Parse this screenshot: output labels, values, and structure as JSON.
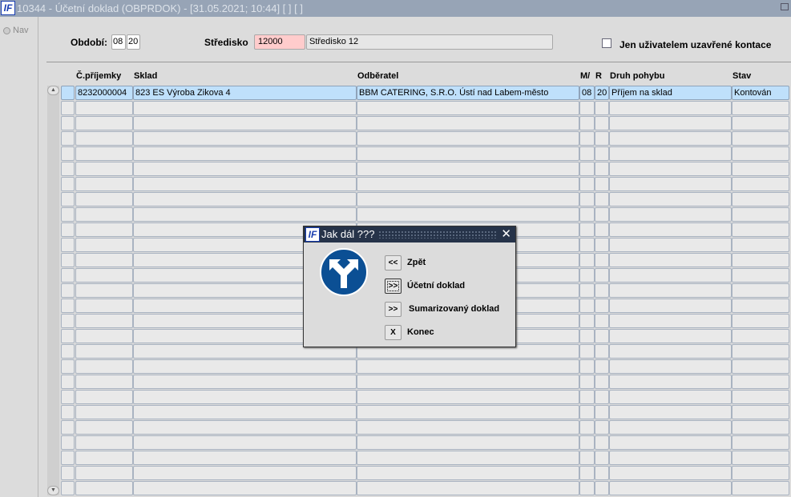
{
  "window": {
    "title": "10344 - Účetní doklad (OBPRDOK) - [31.05.2021; 10:44]  [ ]  [ ]",
    "logo": "IF"
  },
  "nav": {
    "label": "Nav"
  },
  "filter": {
    "obdobi_label": "Období:",
    "obdobi_month": "08",
    "obdobi_year": "20",
    "stredisko_label": "Středisko",
    "stredisko_code": "12000",
    "stredisko_name": "Středisko 12",
    "checkbox_label": "Jen uživatelem uzavřené kontace",
    "checkbox_checked": false
  },
  "table": {
    "headers": [
      "Č.příjemky",
      "Sklad",
      "Odběratel",
      "M/",
      "R",
      "Druh pohybu",
      "Stav"
    ],
    "rows": [
      [
        "8232000004",
        "823 ES Výroba Zikova 4",
        "BBM CATERING, S.R.O. Ústí nad Labem-město",
        "08",
        "20",
        "Příjem na sklad",
        "Kontován"
      ]
    ],
    "empty_rows": 26
  },
  "dialog": {
    "title": "Jak dál ???",
    "close": "✕",
    "buttons": [
      {
        "symbol": "<<",
        "label": "Zpět"
      },
      {
        "symbol": ">>",
        "label": "Účetní doklad",
        "focused": true
      },
      {
        "symbol": ">>",
        "label": "Sumarizovaný doklad"
      },
      {
        "symbol": "X",
        "label": "Konec"
      }
    ]
  }
}
